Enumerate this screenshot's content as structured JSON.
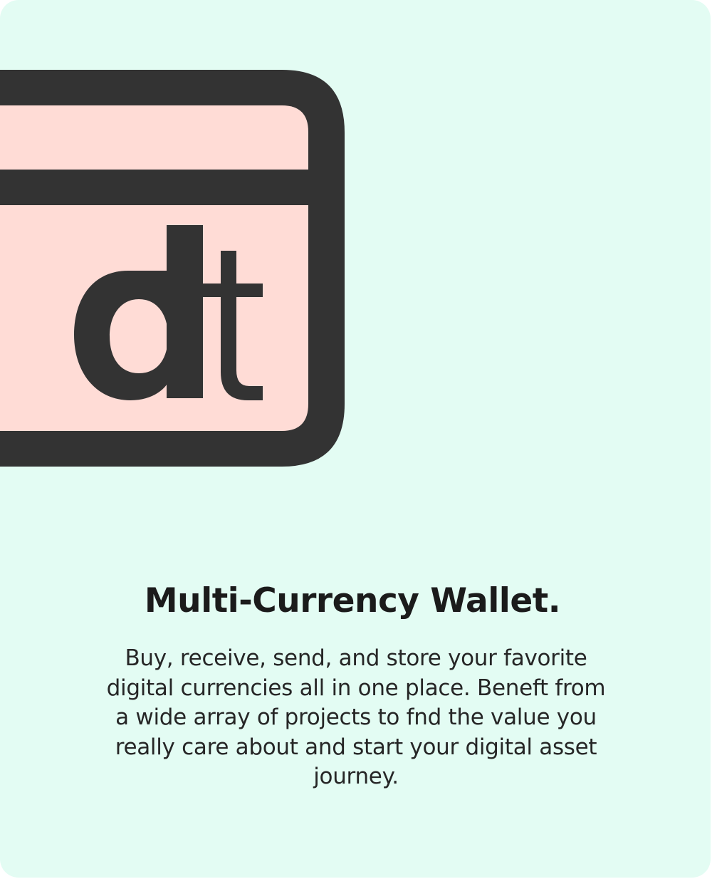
{
  "feature": {
    "title": "Multi-Currency Wallet.",
    "description": "Buy, receive, send, and store your favorite digital currencies all in one place. Beneft from a wide array of projects to fnd the value you really care about and start your digital asset journey.",
    "icon": "wallet-card-icon",
    "logo_text": "dt"
  },
  "colors": {
    "card_background": "#e3fcf3",
    "card_fill": "#ffdcd6",
    "outline": "#333333",
    "text": "#1b1b1b"
  }
}
